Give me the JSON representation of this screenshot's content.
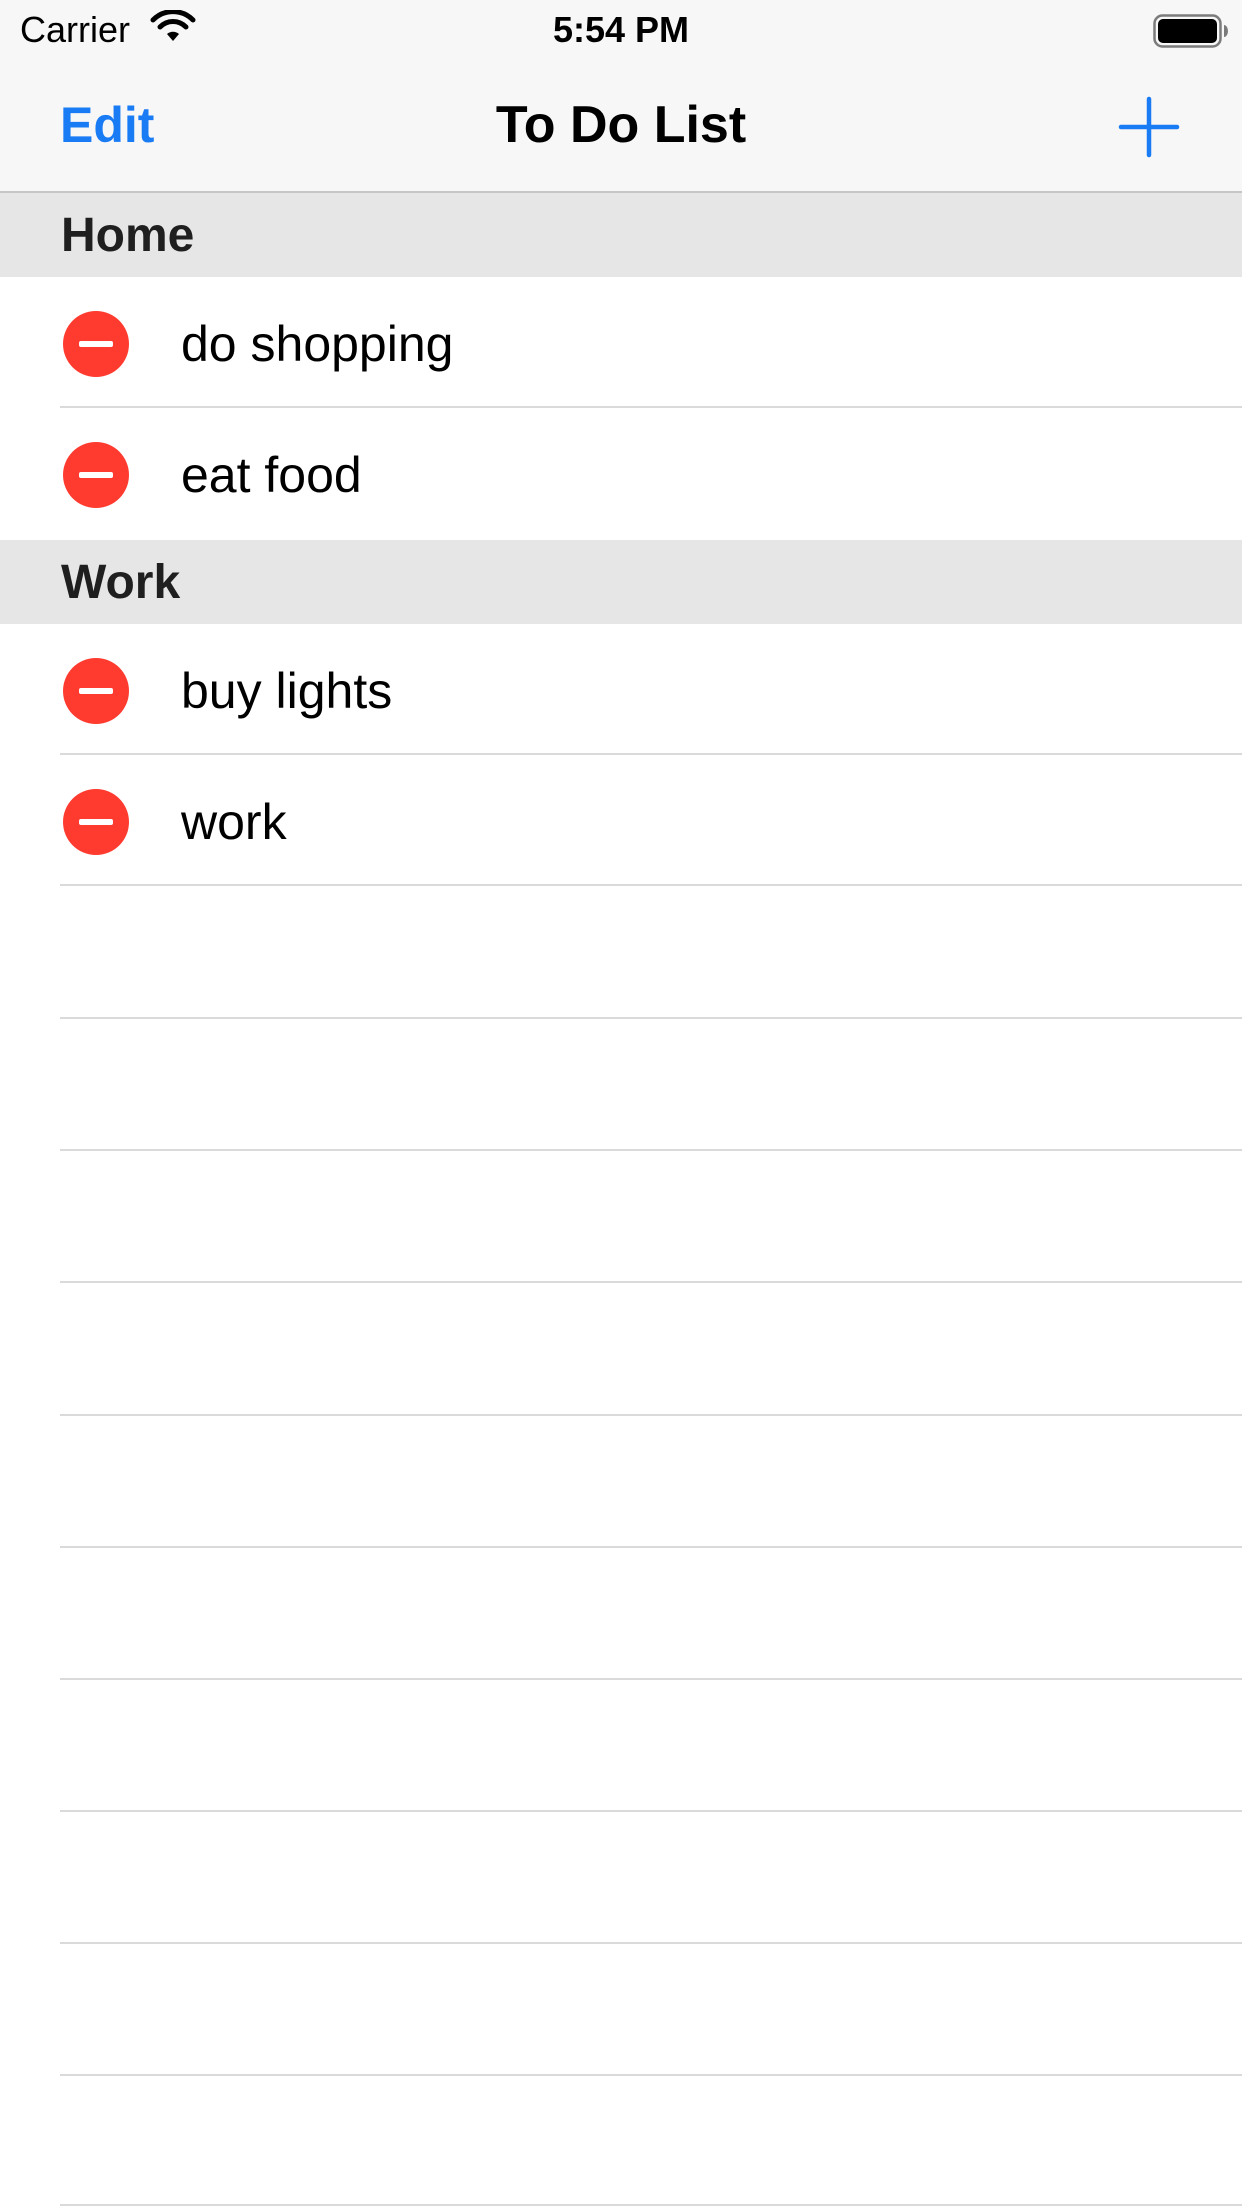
{
  "status_bar": {
    "carrier": "Carrier",
    "time": "5:54 PM",
    "icons": [
      "wifi-icon",
      "battery-icon"
    ]
  },
  "nav": {
    "edit_label": "Edit",
    "title": "To Do List",
    "add_icon": "plus-icon"
  },
  "colors": {
    "accent": "#1a7cf5",
    "delete": "#ff3b30",
    "section_bg": "#e6e6e6",
    "bar_bg": "#f7f7f7"
  },
  "sections": [
    {
      "title": "Home",
      "items": [
        {
          "label": "do shopping",
          "icon": "delete-minus-icon"
        },
        {
          "label": "eat food",
          "icon": "delete-minus-icon"
        }
      ]
    },
    {
      "title": "Work",
      "items": [
        {
          "label": "buy lights",
          "icon": "delete-minus-icon"
        },
        {
          "label": "work",
          "icon": "delete-minus-icon"
        }
      ]
    }
  ]
}
